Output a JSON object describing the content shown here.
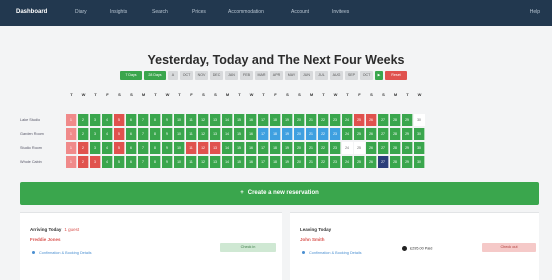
{
  "nav": {
    "brand": "Dashboard",
    "items": [
      "Diary",
      "Insights",
      "Search",
      "Prices",
      "Accommodation",
      "Account",
      "Invitees"
    ],
    "help": "Help"
  },
  "page_title": "Yesterday, Today and The Next Four Weeks",
  "period_chips": [
    {
      "label": "7 Days",
      "style": "green"
    },
    {
      "label": "28 Days",
      "style": "green"
    },
    {
      "label": "A",
      "style": "grey"
    },
    {
      "label": "OCT",
      "style": "grey"
    },
    {
      "label": "NOV",
      "style": "grey"
    },
    {
      "label": "DEC",
      "style": "grey"
    },
    {
      "label": "JAN",
      "style": "grey"
    },
    {
      "label": "FEB",
      "style": "grey"
    },
    {
      "label": "MAR",
      "style": "grey"
    },
    {
      "label": "APR",
      "style": "grey"
    },
    {
      "label": "MAY",
      "style": "grey"
    },
    {
      "label": "JUN",
      "style": "grey"
    },
    {
      "label": "JUL",
      "style": "grey"
    },
    {
      "label": "AUG",
      "style": "grey"
    },
    {
      "label": "SEP",
      "style": "grey"
    },
    {
      "label": "OCT",
      "style": "grey"
    },
    {
      "label": "▶",
      "style": "green"
    },
    {
      "label": "Reset",
      "style": "red"
    }
  ],
  "calendar": {
    "days": [
      "T",
      "W",
      "T",
      "F",
      "S",
      "S",
      "M",
      "T",
      "W",
      "T",
      "F",
      "S",
      "S",
      "M",
      "T",
      "W",
      "T",
      "F",
      "S",
      "S",
      "M",
      "T",
      "W",
      "T",
      "F",
      "S",
      "S",
      "M",
      "T",
      "W"
    ],
    "rooms": [
      "Lake Studio",
      "Garden Room",
      "Studio Room",
      "Whole Cabin"
    ],
    "row_numbers": [
      "1",
      "2",
      "3",
      "4",
      "5",
      "6",
      "7",
      "8",
      "9",
      "10",
      "11",
      "12",
      "13",
      "14",
      "15",
      "16",
      "17",
      "18",
      "19",
      "20",
      "21",
      "22",
      "23",
      "24",
      "25",
      "26",
      "27",
      "28",
      "29",
      "30"
    ]
  },
  "create_label": "Create a new reservation",
  "arriving": {
    "title": "Arriving Today",
    "sub": "1 guest",
    "guest": "Freddie Jones",
    "button": "Check in",
    "link": "Confirmation & Booking Details"
  },
  "leaving": {
    "title": "Leaving Today",
    "guest": "John Smith",
    "paid": "£295.00 Paid",
    "button": "Check out",
    "link": "Confirmation & Booking Details"
  },
  "colors": {
    "nav_bg": "#22384f",
    "green": "#3aa64d",
    "red": "#e0524e",
    "blue": "#3fa0e0",
    "navy": "#2b3e7a"
  }
}
